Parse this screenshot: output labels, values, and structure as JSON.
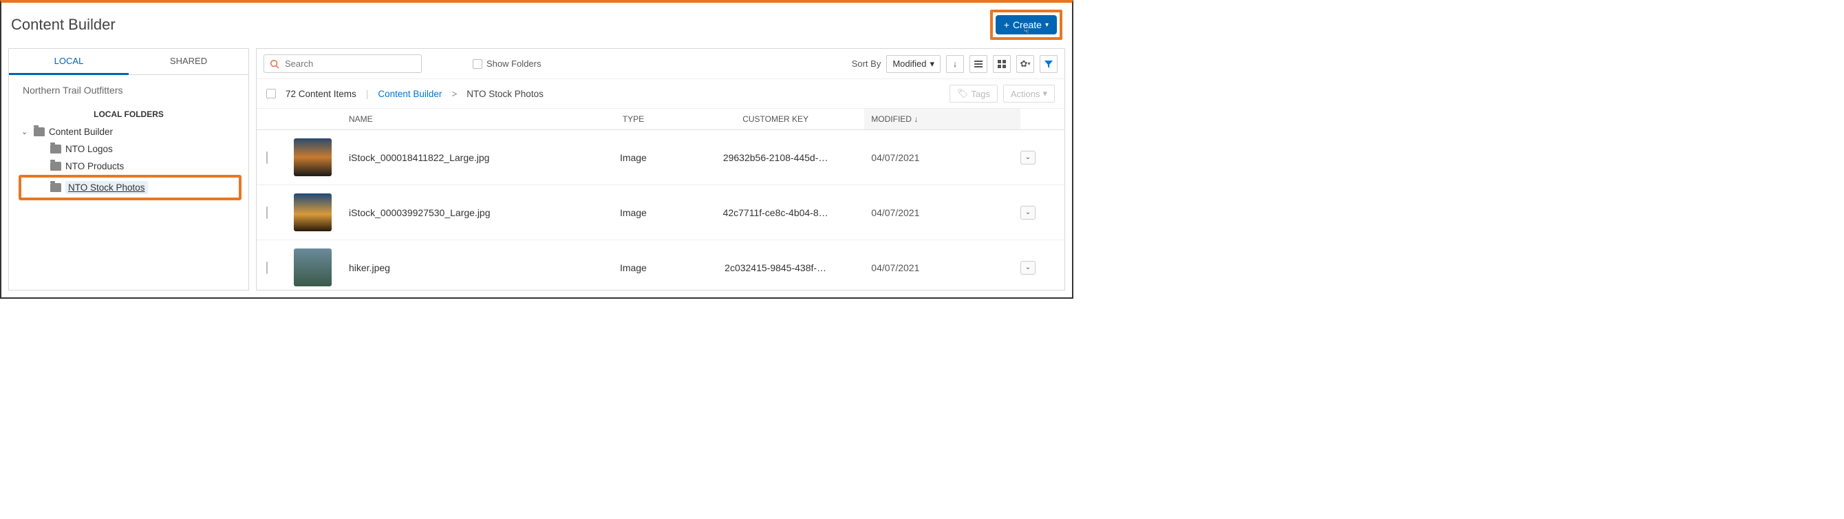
{
  "page_title": "Content Builder",
  "create_label": "Create",
  "sidebar": {
    "tabs": [
      "LOCAL",
      "SHARED"
    ],
    "active_tab": 0,
    "org_name": "Northern Trail Outfitters",
    "folders_header": "LOCAL FOLDERS",
    "root": "Content Builder",
    "children": [
      "NTO Logos",
      "NTO Products",
      "NTO Stock Photos"
    ],
    "selected_index": 2
  },
  "toolbar": {
    "search_placeholder": "Search",
    "show_folders_label": "Show Folders",
    "sort_by_label": "Sort By",
    "sort_value": "Modified"
  },
  "subbar": {
    "count_text": "72 Content Items",
    "breadcrumb_root": "Content Builder",
    "breadcrumb_current": "NTO Stock Photos",
    "tags_label": "Tags",
    "actions_label": "Actions"
  },
  "columns": {
    "name": "NAME",
    "type": "TYPE",
    "key": "CUSTOMER KEY",
    "modified": "MODIFIED"
  },
  "rows": [
    {
      "name": "iStock_000018411822_Large.jpg",
      "type": "Image",
      "key": "29632b56-2108-445d-…",
      "modified": "04/07/2021",
      "thumb": "t1"
    },
    {
      "name": "iStock_000039927530_Large.jpg",
      "type": "Image",
      "key": "42c7711f-ce8c-4b04-8…",
      "modified": "04/07/2021",
      "thumb": "t2"
    },
    {
      "name": "hiker.jpeg",
      "type": "Image",
      "key": "2c032415-9845-438f-…",
      "modified": "04/07/2021",
      "thumb": "t3"
    }
  ]
}
